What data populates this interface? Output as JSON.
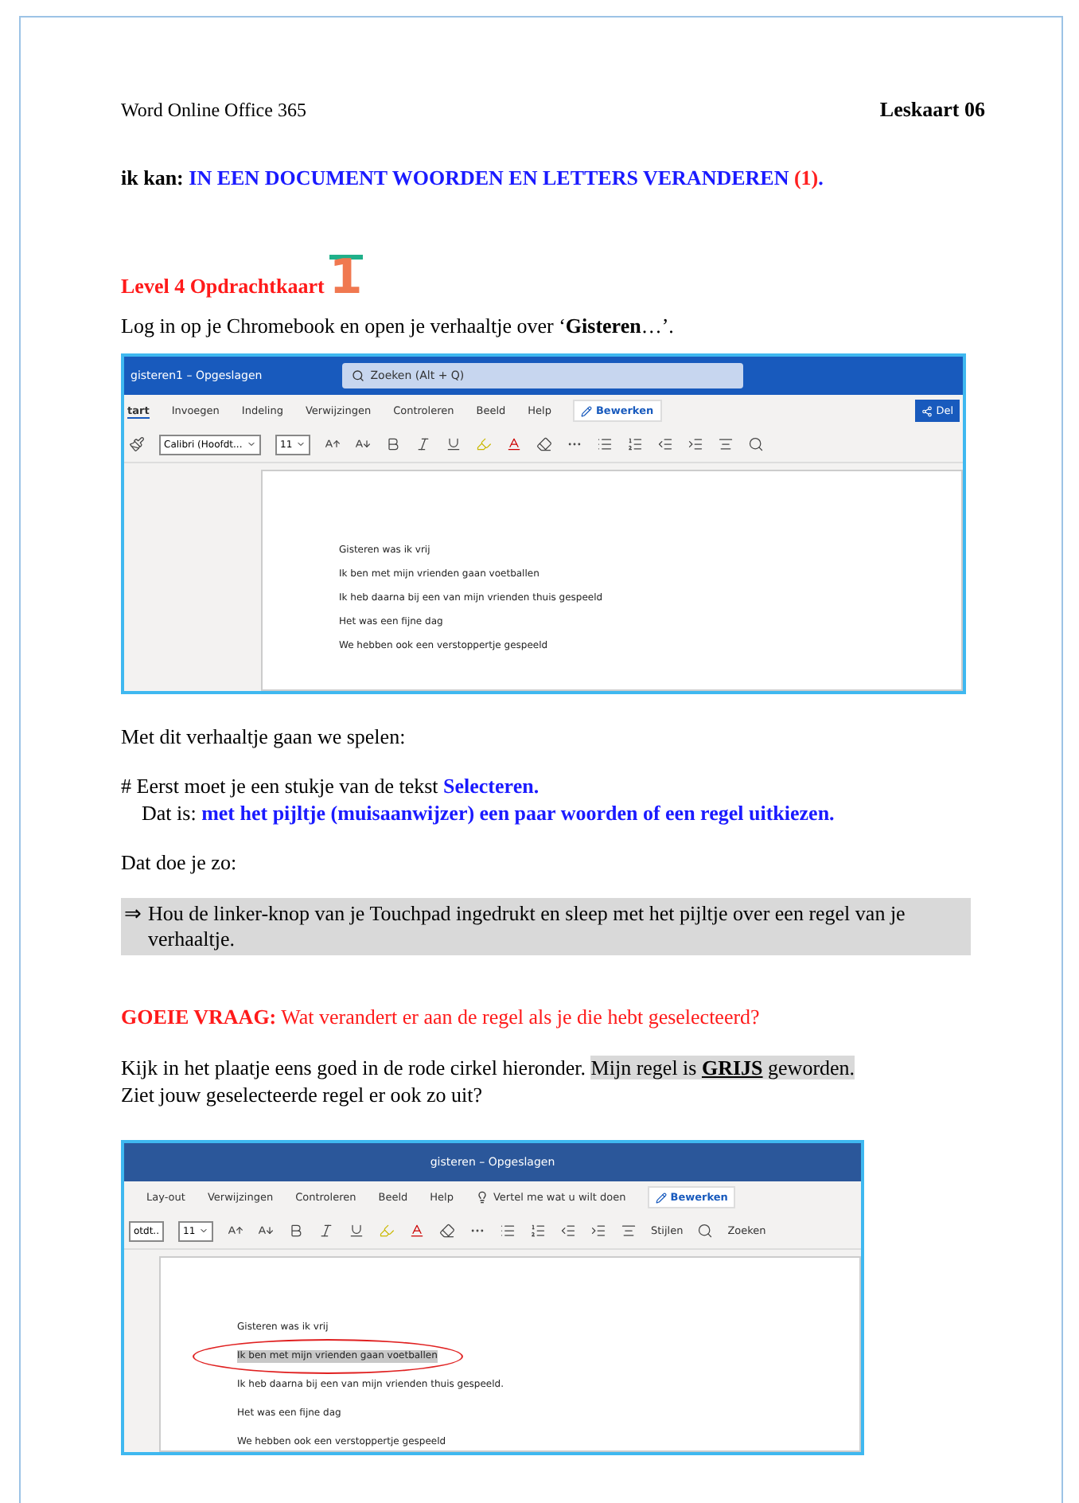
{
  "header": {
    "left": "Word Online Office 365",
    "right": "Leskaart 06"
  },
  "goal": {
    "label": "ik kan:",
    "text": "IN EEN DOCUMENT WOORDEN EN LETTERS VERANDEREN",
    "mark": "(1)",
    "end": "."
  },
  "level": {
    "title": "Level 4 Opdrachtkaart",
    "number": "1"
  },
  "intro": "Log in op je Chromebook en open je verhaaltje over ‘**Gisteren**…’.",
  "screenshot_1": {
    "doc_title": "gisteren1 – Opgeslagen",
    "search_placeholder": "Zoeken (Alt + Q)",
    "tabs": [
      {
        "label": "tart",
        "selected": true
      },
      {
        "label": "Invoegen",
        "selected": false
      },
      {
        "label": "Indeling",
        "selected": false
      },
      {
        "label": "Verwijzingen",
        "selected": false
      },
      {
        "label": "Controleren",
        "selected": false
      },
      {
        "label": "Beeld",
        "selected": false
      },
      {
        "label": "Help",
        "selected": false
      }
    ],
    "edit_button": "Bewerken",
    "share_button": "Del",
    "font": "Calibri (Hoofdt...",
    "size": "11",
    "lines": [
      {
        "text": "Gisteren was ik vrij",
        "selected": false
      },
      {
        "text": "Ik ben met mijn vrienden gaan voetballen",
        "selected": false
      },
      {
        "text": "Ik heb daarna bij een van mijn vrienden thuis gespeeld",
        "selected": false
      },
      {
        "text": "Het was een fijne dag",
        "selected": false
      },
      {
        "text": "We hebben ook een verstoppertje gespeeld",
        "selected": false
      }
    ]
  },
  "play": "Met dit verhaaltje gaan we spelen:",
  "step": {
    "line_1": "# Eerst moet je een stukje van de tekst",
    "line_1_key": "Selecteren.",
    "line_2": "Dat is:",
    "line_2_key": "met het pijltje (muisaanwijzer) een paar woorden of een regel uitkiezen."
  },
  "how": "Dat doe je zo:",
  "instruction": {
    "arrow": "⇒",
    "text": "Hou de linker-knop van je Touchpad ingedrukt en sleep met het pijltje over een regel van je verhaaltje."
  },
  "question": {
    "label": "GOEIE VRAAG:",
    "text": "Wat verandert er aan de regel als je die hebt geselecteerd?"
  },
  "look": {
    "text": "Kijk in het plaatje eens goed in de rode cirkel hieronder.",
    "highlight": "Mijn regel is **GRIJS** geworden.",
    "line_2": "Ziet jouw geselecteerde regel er ook zo uit?"
  },
  "screenshot_2": {
    "doc_title": "gisteren – Opgeslagen",
    "tabs": [
      {
        "label": "Lay-out",
        "selected": false
      },
      {
        "label": "Verwijzingen",
        "selected": false
      },
      {
        "label": "Controleren",
        "selected": false
      },
      {
        "label": "Beeld",
        "selected": false
      },
      {
        "label": "Help",
        "selected": false
      }
    ],
    "tell_me": "Vertel me wat u wilt doen",
    "edit_button": "Bewerken",
    "font": "otdt..",
    "size": "11",
    "styles": "Stijlen",
    "find": "Zoeken",
    "lines": [
      {
        "text": "Gisteren was ik vrij",
        "selected": false
      },
      {
        "text": "Ik ben met mijn vrienden gaan voetballen",
        "selected": true
      },
      {
        "text": "Ik heb daarna bij een van mijn vrienden thuis gespeeld.",
        "selected": false
      },
      {
        "text": "Het was een fijne dag",
        "selected": false
      },
      {
        "text": "We hebben ook een verstoppertje gespeeld",
        "selected": false
      }
    ]
  }
}
